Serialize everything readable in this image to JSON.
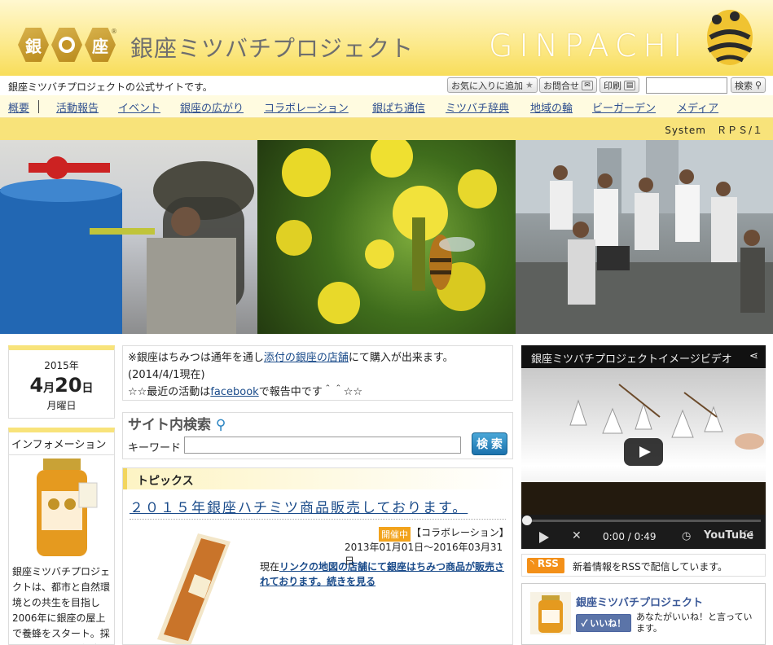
{
  "header": {
    "logo_chars": [
      "銀",
      "座"
    ],
    "registered": "®",
    "site_title": "銀座ミツバチプロジェクト",
    "brand_en": "GINPACHI"
  },
  "utility": {
    "tagline": "銀座ミツバチプロジェクトの公式サイトです。",
    "favorites_label": "お気に入りに追加",
    "contact_label": "お問合せ",
    "print_label": "印刷",
    "search_value": "",
    "search_label": "検索"
  },
  "nav": {
    "items": [
      "概要",
      "活動報告",
      "イベント",
      "銀座の広がり",
      "コラボレーション",
      "銀ぱち通信",
      "ミツバチ辞典",
      "地域の輪",
      "ビーガーデン",
      "メディア"
    ]
  },
  "system_bar": {
    "text": "System　ＲＰＳ/１"
  },
  "date": {
    "year": "2015年",
    "month": "4",
    "month_unit": "月",
    "day": "20",
    "day_unit": "日",
    "weekday": "月曜日"
  },
  "info": {
    "title": "インフォメーション",
    "text": "銀座ミツバチプロジェクトは、都市と自然環境との共生を目指し2006年に銀座の屋上で養蜂をスタート。採れたハチミツは銀座の"
  },
  "notice": {
    "line1_pre": "※銀座はちみつは通年を通し",
    "line1_link": "添付の銀座の店舗",
    "line1_post": "にて購入が出来ます。",
    "line2": "(2014/4/1現在)",
    "line3_pre": "☆☆最近の活動は",
    "line3_link": "facebook",
    "line3_post": "で報告中です＾＾☆☆"
  },
  "site_search": {
    "title": "サイト内検索",
    "keyword_label": "キーワード",
    "keyword_value": "",
    "button_label": "検 索"
  },
  "topics": {
    "title": "トピックス",
    "headline": "２０１５年銀座ハチミツ商品販売しております。",
    "badge": "開催中",
    "category": "【コラボレーション】",
    "period": "2013年01月01日～2016年03月31日",
    "body_pre": "現在",
    "body_link": "リンクの地図の店舗にて銀座はちみつ商品が販売されております。続きを見る"
  },
  "video": {
    "title": "銀座ミツバチプロジェクトイメージビデオ",
    "time": "0:00 / 0:49",
    "youtube": "YouTube",
    "progress": 0
  },
  "rss": {
    "badge": "RSS",
    "text": "新着情報をRSSで配信しています。"
  },
  "facebook": {
    "page_name": "銀座ミツバチプロジェクト",
    "like_label": "いいね！",
    "text": "あなたがいいね！と言っています。"
  },
  "colors": {
    "header_yellow": "#f8dd5a",
    "accent_yellow": "#f8e37a",
    "link_blue": "#1a4b8a",
    "rss_orange": "#f39019",
    "badge_orange": "#f2a31c",
    "facebook_blue": "#5b74a8"
  }
}
